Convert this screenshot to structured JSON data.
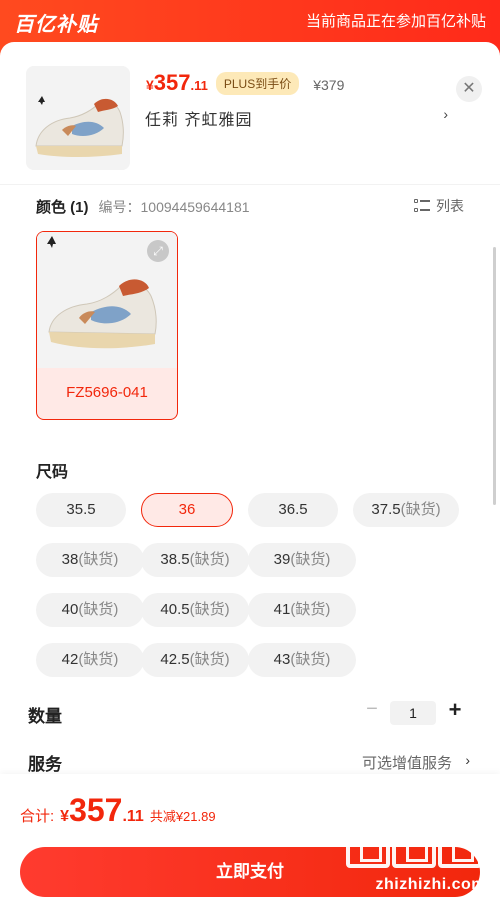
{
  "banner": {
    "logo": "百亿补贴",
    "note": "当前商品正在参加百亿补贴"
  },
  "product": {
    "price_symbol": "¥",
    "price_int": "357",
    "price_dec": ".11",
    "plus_badge": "PLUS到手价",
    "plus_price": "¥379",
    "address": "任莉  齐虹雅园",
    "address_arrow": "›",
    "close_icon": "close-icon"
  },
  "color_section": {
    "title": "颜色 (1)",
    "code_label": "编号：10094459644181",
    "list_toggle": "列表",
    "selected_label": "FZ5696-041",
    "expand_icon": "expand-icon"
  },
  "size_section": {
    "title": "尺码",
    "sizes": [
      {
        "value": "35.5",
        "note": "",
        "selected": false
      },
      {
        "value": "36",
        "note": "",
        "selected": true
      },
      {
        "value": "36.5",
        "note": "",
        "selected": false
      },
      {
        "value": "37.5",
        "note": "(缺货)",
        "selected": false
      },
      {
        "value": "38",
        "note": "(缺货)",
        "selected": false
      },
      {
        "value": "38.5",
        "note": "(缺货)",
        "selected": false
      },
      {
        "value": "39",
        "note": "(缺货)",
        "selected": false
      },
      {
        "value": "40",
        "note": "(缺货)",
        "selected": false
      },
      {
        "value": "40.5",
        "note": "(缺货)",
        "selected": false
      },
      {
        "value": "41",
        "note": "(缺货)",
        "selected": false
      },
      {
        "value": "42",
        "note": "(缺货)",
        "selected": false
      },
      {
        "value": "42.5",
        "note": "(缺货)",
        "selected": false
      },
      {
        "value": "43",
        "note": "(缺货)",
        "selected": false
      }
    ]
  },
  "quantity": {
    "label": "数量",
    "minus": "−",
    "value": "1",
    "plus": "+"
  },
  "service": {
    "label": "服务",
    "value": "可选增值服务",
    "arrow": "›"
  },
  "footer": {
    "total_label": "合计:",
    "total_symbol": "¥",
    "total_int": "357",
    "total_dec": ".11",
    "saved": "共减¥21.89",
    "pay_button": "立即支付"
  },
  "watermark": {
    "text": "zhizhizhi.com"
  },
  "colors": {
    "accent": "#f2270c",
    "banner": "#ff3a1d",
    "plus_badge_bg": "#fde9b8"
  }
}
